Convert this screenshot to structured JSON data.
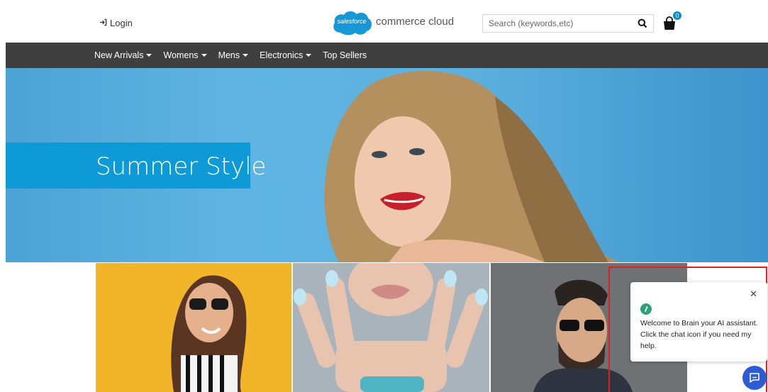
{
  "header": {
    "login_label": "Login",
    "logo": {
      "cloud_text": "salesforce",
      "text": "commerce cloud"
    },
    "search": {
      "placeholder": "Search (keywords,etc)"
    },
    "cart": {
      "count": "0"
    }
  },
  "nav": {
    "items": [
      {
        "label": "New Arrivals",
        "dropdown": true
      },
      {
        "label": "Womens",
        "dropdown": true
      },
      {
        "label": "Mens",
        "dropdown": true
      },
      {
        "label": "Electronics",
        "dropdown": true
      },
      {
        "label": "Top Sellers",
        "dropdown": false
      }
    ]
  },
  "hero": {
    "title": "Summer Style"
  },
  "chat": {
    "close_icon": "close-icon",
    "message": "Welcome to Brain your AI assistant. Click the chat icon if you need my help."
  },
  "colors": {
    "nav_bg": "#3f3f3f",
    "hero_tag": "#0e9ad7",
    "brand_blue": "#0a8bc4",
    "chat_fab": "#2d5bd6",
    "highlight": "#e02020"
  }
}
